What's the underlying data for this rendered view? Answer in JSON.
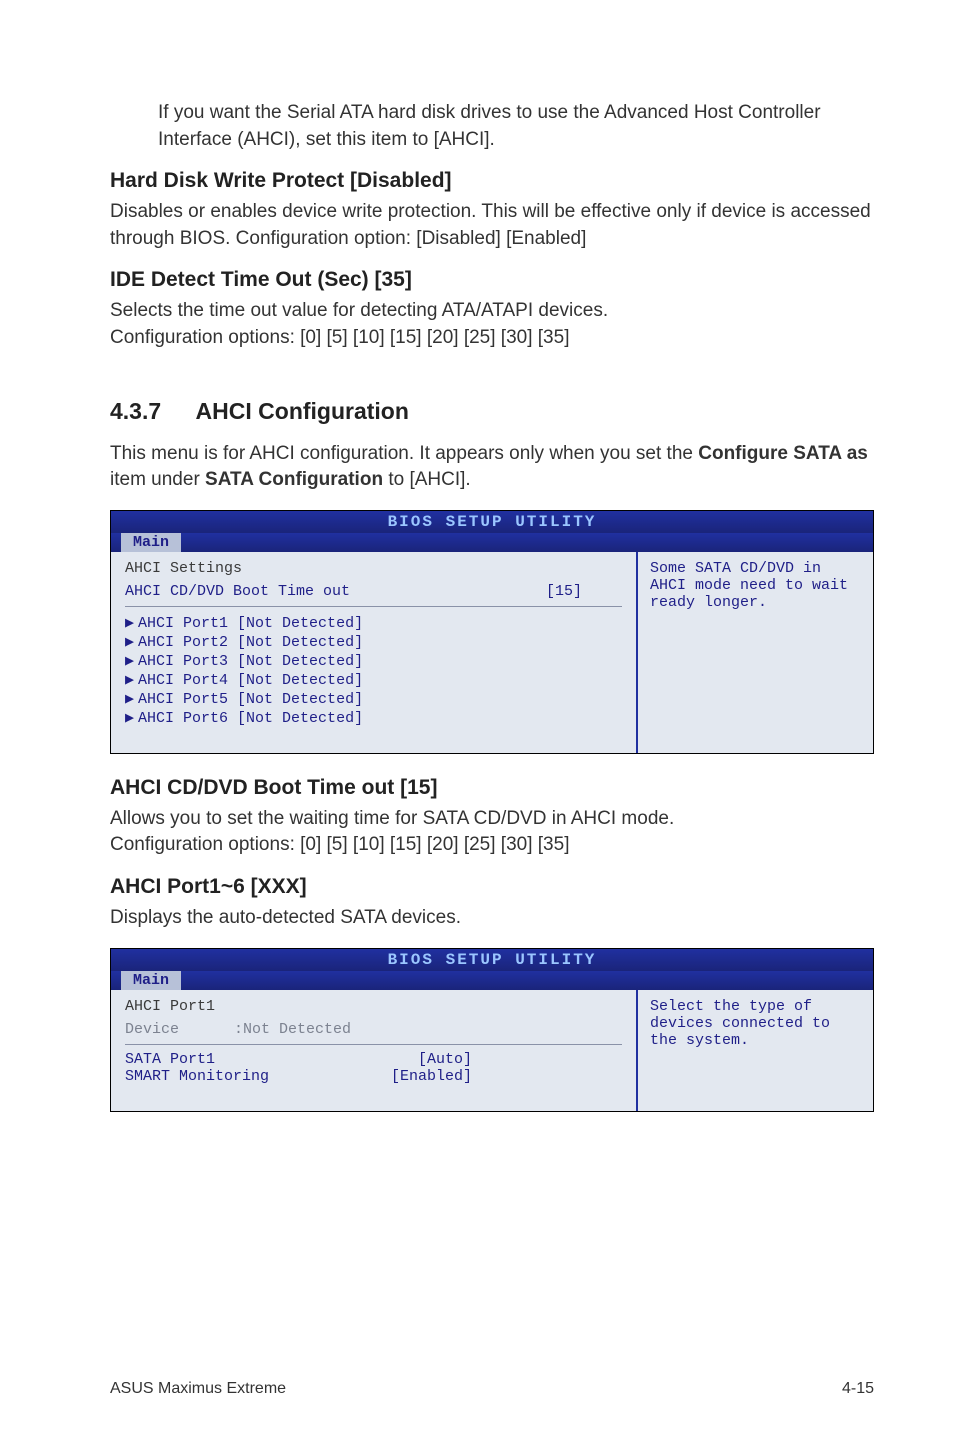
{
  "intro": {
    "para": "If you want the Serial ATA hard disk drives to use the Advanced Host Controller Interface (AHCI), set this item to [AHCI]."
  },
  "hdwp": {
    "heading": "Hard Disk Write Protect [Disabled]",
    "para": "Disables or enables device write protection. This will be effective only if device is accessed through BIOS. Configuration option: [Disabled] [Enabled]"
  },
  "ide": {
    "heading": "IDE Detect Time Out (Sec) [35]",
    "para1": "Selects the time out value for detecting ATA/ATAPI devices.",
    "para2": "Configuration options: [0] [5] [10] [15] [20] [25] [30] [35]"
  },
  "chapter": {
    "num": "4.3.7",
    "title": "AHCI Configuration",
    "intro_pre": "This menu is for AHCI configuration. It appears only when you set the ",
    "intro_b1": "Configure SATA as",
    "intro_mid": " item under ",
    "intro_b2": "SATA Configuration",
    "intro_post": " to [AHCI]."
  },
  "bios1": {
    "title": "BIOS SETUP UTILITY",
    "tab": "Main",
    "heading": "AHCI Settings",
    "setting_label": "AHCI CD/DVD Boot Time out",
    "setting_val": "[15]",
    "items": [
      "AHCI Port1 [Not Detected]",
      "AHCI Port2 [Not Detected]",
      "AHCI Port3 [Not Detected]",
      "AHCI Port4 [Not Detected]",
      "AHCI Port5 [Not Detected]",
      "AHCI Port6 [Not Detected]"
    ],
    "help": "Some SATA CD/DVD in AHCI mode need to wait ready longer."
  },
  "cdsect": {
    "heading": "AHCI CD/DVD Boot Time out [15]",
    "para1": "Allows you to set the waiting time for SATA CD/DVD in AHCI mode.",
    "para2": "Configuration options: [0] [5] [10] [15] [20] [25] [30] [35]"
  },
  "portsect": {
    "heading": "AHCI Port1~6 [XXX]",
    "para": "Displays the auto-detected SATA devices."
  },
  "bios2": {
    "title": "BIOS SETUP UTILITY",
    "tab": "Main",
    "heading": "AHCI Port1",
    "grey_label": "Device",
    "grey_val": ":Not Detected",
    "r1_label": "SATA Port1",
    "r1_val": "[Auto]",
    "r2_label": "SMART Monitoring",
    "r2_val": "[Enabled]",
    "help": "Select the type of devices connected to the system."
  },
  "footer": {
    "left": "ASUS Maximus Extreme",
    "right": "4-15"
  }
}
